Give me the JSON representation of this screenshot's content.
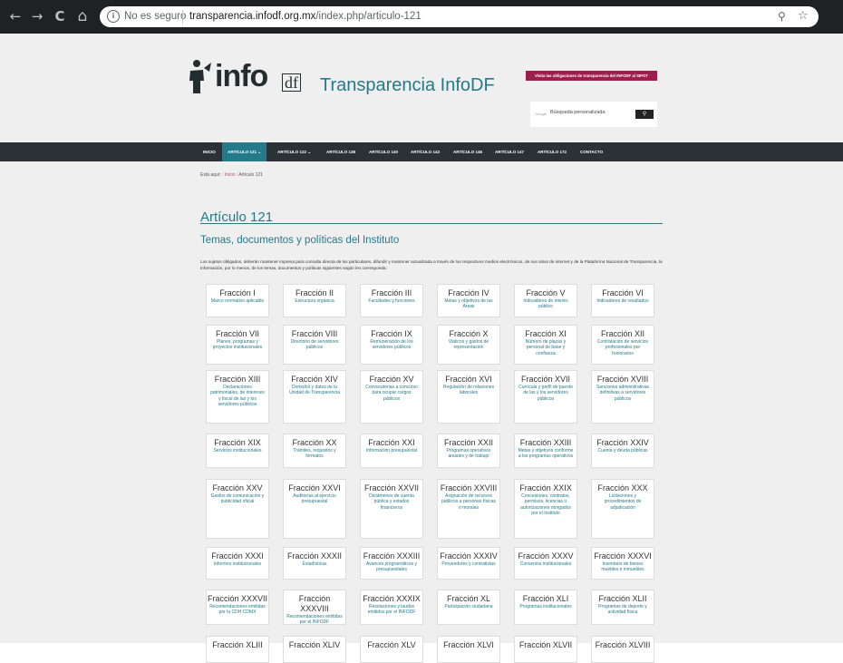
{
  "browser": {
    "back_glyph": "←",
    "forward_glyph": "→",
    "reload_glyph": "C",
    "home_glyph": "⌂",
    "info_glyph": "i",
    "insecure_label": "No es seguro",
    "url_host": "transparencia.infodf.org.mx",
    "url_path": "/index.php/articulo-121",
    "zoom_glyph": "⚲",
    "star_glyph": "☆"
  },
  "header": {
    "logo_word": "info",
    "logo_suffix": "df",
    "site_title": "Transparencia InfoDF",
    "spot_button": "Visita las obligaciones de transparencia del INFODF al SIPOT",
    "search_brand": "Google",
    "search_placeholder": "Búsqueda personalizada",
    "search_glyph": "⚲"
  },
  "nav": [
    {
      "label": "INICIO"
    },
    {
      "label": "ARTÍCULO 121  ⌄"
    },
    {
      "label": "ARTÍCULO 122  ⌄"
    },
    {
      "label": "ARTÍCULO 138"
    },
    {
      "label": "ARTÍCULO 140"
    },
    {
      "label": "ARTÍCULO 143"
    },
    {
      "label": "ARTÍCULO 146"
    },
    {
      "label": "ARTÍCULO 147"
    },
    {
      "label": "ARTÍCULO 172"
    },
    {
      "label": "CONTACTO"
    }
  ],
  "breadcrumb": {
    "prefix": "Está aquí:",
    "home": "Inicio",
    "divider": "/",
    "current": "Artículo 121"
  },
  "page": {
    "title": "Artículo 121",
    "subtitle": "Temas, documentos y políticas del Instituto",
    "intro": "Los sujetos obligados, deberán mantener impresa para consulta directa de los particulares, difundir y mantener actualizada a través de los respectivos medios electrónicos, de sus sitios de internet y de la Plataforma Nacional de Transparencia, la información, por lo menos, de los temas, documentos y políticas siguientes según les corresponda:"
  },
  "fracciones": [
    {
      "num": "Fracción I",
      "desc": "Marco normativo aplicable"
    },
    {
      "num": "Fracción II",
      "desc": "Estructura orgánica"
    },
    {
      "num": "Fracción III",
      "desc": "Facultades y funciones"
    },
    {
      "num": "Fracción IV",
      "desc": "Metas y objetivos de las Áreas"
    },
    {
      "num": "Fracción V",
      "desc": "Indicadores de interés público"
    },
    {
      "num": "Fracción VI",
      "desc": "Indicadores de resultados"
    },
    {
      "num": "Fracción VII",
      "desc": "Planes, programas y proyectos institucionales"
    },
    {
      "num": "Fracción VIII",
      "desc": "Directorio de servidores públicos"
    },
    {
      "num": "Fracción IX",
      "desc": "Remuneración de los servidores públicos"
    },
    {
      "num": "Fracción X",
      "desc": "Viáticos y gastos de representación"
    },
    {
      "num": "Fracción XI",
      "desc": "Número de plazas y personal de base y confianza"
    },
    {
      "num": "Fracción XII",
      "desc": "Contratación de servicios profesionales por honorarios"
    },
    {
      "num": "Fracción XIII",
      "desc": "Declaraciones patrimoniales, de intereses y fiscal de las y los servidores públicos"
    },
    {
      "num": "Fracción XIV",
      "desc": "Domicilio y datos de la Unidad de Transparencia"
    },
    {
      "num": "Fracción XV",
      "desc": "Convocatorias a concurso para ocupar cargos públicos"
    },
    {
      "num": "Fracción XVI",
      "desc": "Regulación de relaciones laborales"
    },
    {
      "num": "Fracción XVII",
      "desc": "Currícula y perfil de puesto de las y los servidores públicos"
    },
    {
      "num": "Fracción XVIII",
      "desc": "Sanciones administrativas definitivas a servidores públicos"
    },
    {
      "num": "Fracción XIX",
      "desc": "Servicios institucionales"
    },
    {
      "num": "Fracción XX",
      "desc": "Trámites, requisitos y formatos"
    },
    {
      "num": "Fracción XXI",
      "desc": "Información presupuestal"
    },
    {
      "num": "Fracción XXII",
      "desc": "Programas operativos anuales y de trabajo"
    },
    {
      "num": "Fracción XXIII",
      "desc": "Metas y objetivos conforme a los programas operativos"
    },
    {
      "num": "Fracción XXIV",
      "desc": "Cuenta y deuda públicas"
    },
    {
      "num": "Fracción XXV",
      "desc": "Gastos de comunicación y publicidad oficial"
    },
    {
      "num": "Fracción XXVI",
      "desc": "Auditorías al ejercicio presupuestal"
    },
    {
      "num": "Fracción XXVII",
      "desc": "Dictámenes de cuenta pública y estados financieros"
    },
    {
      "num": "Fracción XXVIII",
      "desc": "Asignación de recursos públicos a personas físicas o morales"
    },
    {
      "num": "Fracción XXIX",
      "desc": "Concesiones, contratos, permisos, licencias o autorizaciones otorgados por el Instituto"
    },
    {
      "num": "Fracción XXX",
      "desc": "Licitaciones y procedimientos de adjudicación"
    },
    {
      "num": "Fracción XXXI",
      "desc": "Informes institucionales"
    },
    {
      "num": "Fracción XXXII",
      "desc": "Estadísticas"
    },
    {
      "num": "Fracción XXXIII",
      "desc": "Avances programáticos y presupuestales"
    },
    {
      "num": "Fracción XXXIV",
      "desc": "Proveedores y contratistas"
    },
    {
      "num": "Fracción XXXV",
      "desc": "Convenios institucionales"
    },
    {
      "num": "Fracción XXXVI",
      "desc": "Inventario de bienes muebles e inmuebles"
    },
    {
      "num": "Fracción XXXVII",
      "desc": "Recomendaciones emitidas por la CDH CDMX"
    },
    {
      "num": "Fracción XXXVIII",
      "desc": "Recomendaciones emitidas por el INFODF"
    },
    {
      "num": "Fracción XXXIX",
      "desc": "Resoluciones y laudos emitidos por el INFODF"
    },
    {
      "num": "Fracción XL",
      "desc": "Participación ciudadana"
    },
    {
      "num": "Fracción XLI",
      "desc": "Programas institucionales"
    },
    {
      "num": "Fracción XLII",
      "desc": "Programas de deporte y actividad física"
    },
    {
      "num": "Fracción XLIII",
      "desc": ""
    },
    {
      "num": "Fracción XLIV",
      "desc": ""
    },
    {
      "num": "Fracción XLV",
      "desc": ""
    },
    {
      "num": "Fracción XLVI",
      "desc": ""
    },
    {
      "num": "Fracción XLVII",
      "desc": ""
    },
    {
      "num": "Fracción XLVIII",
      "desc": ""
    }
  ]
}
